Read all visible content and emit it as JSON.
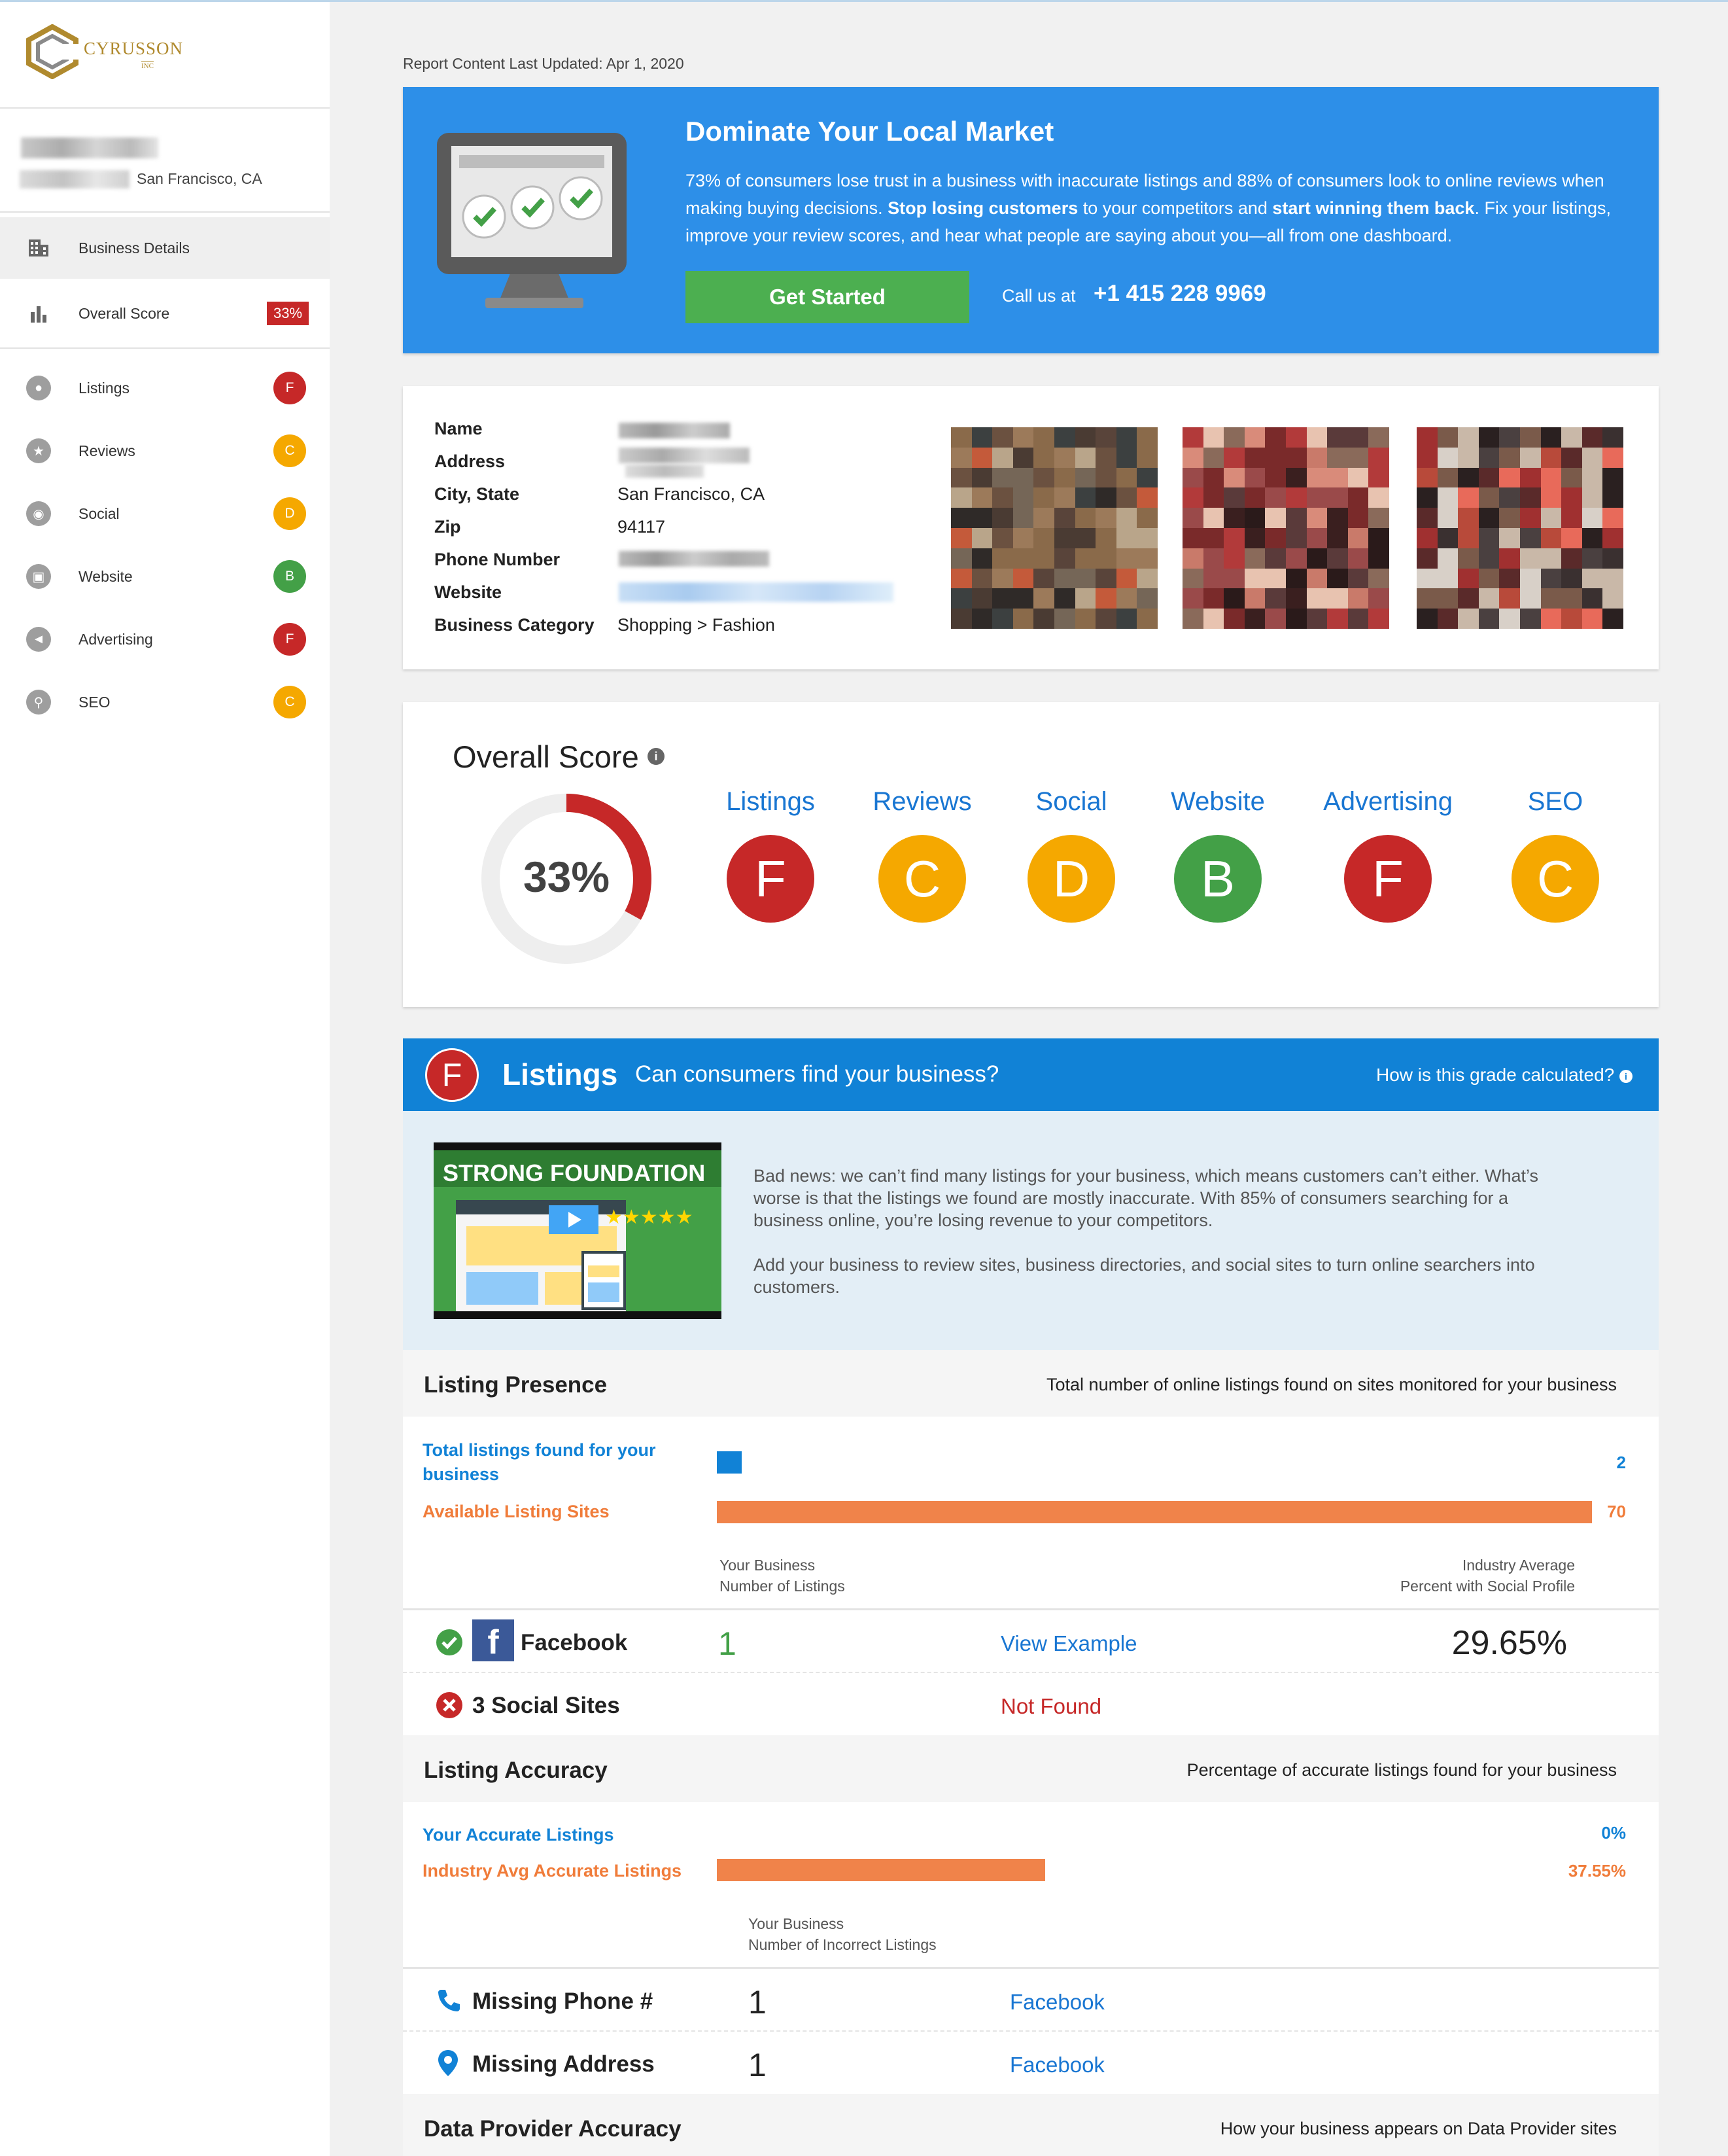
{
  "brand": {
    "name": "CYRUSSON",
    "sub": "INC"
  },
  "sidebar": {
    "business_city": "San Francisco, CA",
    "items": [
      {
        "label": "Business Details",
        "icon": "building-icon"
      },
      {
        "label": "Overall Score",
        "icon": "bar-chart-icon",
        "badge": "33%"
      },
      {
        "label": "Listings",
        "icon": "map-pin-icon",
        "grade": "F"
      },
      {
        "label": "Reviews",
        "icon": "star-icon",
        "grade": "C"
      },
      {
        "label": "Social",
        "icon": "chat-bubble-icon",
        "grade": "D"
      },
      {
        "label": "Website",
        "icon": "browser-window-icon",
        "grade": "B"
      },
      {
        "label": "Advertising",
        "icon": "megaphone-icon",
        "grade": "F"
      },
      {
        "label": "SEO",
        "icon": "magnifier-icon",
        "grade": "C"
      }
    ]
  },
  "updated": "Report Content Last Updated:  Apr 1, 2020",
  "hero": {
    "title": "Dominate Your Local Market",
    "text_1": "73% of consumers lose trust in a business with inaccurate listings and 88% of consumers look to online reviews when making buying decisions. ",
    "bold_1": "Stop losing customers",
    "text_2": " to your competitors and ",
    "bold_2": "start winning them back",
    "text_3": ". Fix your listings, improve your review scores, and hear what people are saying about you—all from one dashboard.",
    "cta": "Get Started",
    "call_label": "Call us at",
    "phone": "+1 415 228 9969"
  },
  "business": {
    "labels": [
      "Name",
      "Address",
      "City, State",
      "Zip",
      "Phone Number",
      "Website",
      "Business Category"
    ],
    "city_state": "San Francisco, CA",
    "zip": "94117",
    "category": "Shopping > Fashion"
  },
  "overall": {
    "title": "Overall Score",
    "score": "33%",
    "score_fraction": 0.33,
    "categories": [
      {
        "name": "Listings",
        "grade": "F"
      },
      {
        "name": "Reviews",
        "grade": "C"
      },
      {
        "name": "Social",
        "grade": "D"
      },
      {
        "name": "Website",
        "grade": "B"
      },
      {
        "name": "Advertising",
        "grade": "F"
      },
      {
        "name": "SEO",
        "grade": "C"
      }
    ]
  },
  "grade_colors": {
    "F": "#c62828",
    "C": "#f5a800",
    "D": "#f5a800",
    "B": "#43a047"
  },
  "listings": {
    "grade": "F",
    "title": "Listings",
    "subtitle": "Can consumers find your business?",
    "how": "How is this grade calculated?",
    "video_title": "STRONG FOUNDATION",
    "intro_1": "Bad news: we can’t find many listings for your business, which means customers can’t either. What’s worse is that the listings we found are mostly inaccurate. With 85% of consumers searching for a business online, you’re losing revenue to your competitors.",
    "intro_2": "Add your business to review sites, business directories, and social sites to turn online searchers into customers.",
    "presence": {
      "title": "Listing Presence",
      "desc": "Total number of online listings found on sites monitored for your business",
      "total_label": "Total listings found for your business",
      "total_value": "2",
      "available_label": "Available Listing Sites",
      "available_value": "70",
      "cap_left_1": "Your Business",
      "cap_left_2": "Number of Listings",
      "cap_right_1": "Industry Average",
      "cap_right_2": "Percent with Social Profile",
      "facebook_name": "Facebook",
      "facebook_count": "1",
      "facebook_link": "View Example",
      "facebook_pct": "29.65%",
      "social_name": "3 Social Sites",
      "social_status": "Not Found"
    },
    "accuracy": {
      "title": "Listing Accuracy",
      "desc": "Percentage of accurate listings found for your business",
      "yours_label": "Your Accurate Listings",
      "yours_value": "0%",
      "yours_fraction": 0.0,
      "avg_label": "Industry Avg Accurate Listings",
      "avg_value": "37.55%",
      "avg_fraction": 0.3755,
      "cap_1": "Your Business",
      "cap_2": "Number of Incorrect Listings",
      "phone_name": "Missing Phone #",
      "phone_count": "1",
      "phone_link": "Facebook",
      "address_name": "Missing Address",
      "address_count": "1",
      "address_link": "Facebook"
    },
    "provider": {
      "title": "Data Provider Accuracy",
      "desc": "How your business appears on Data Provider sites"
    }
  }
}
